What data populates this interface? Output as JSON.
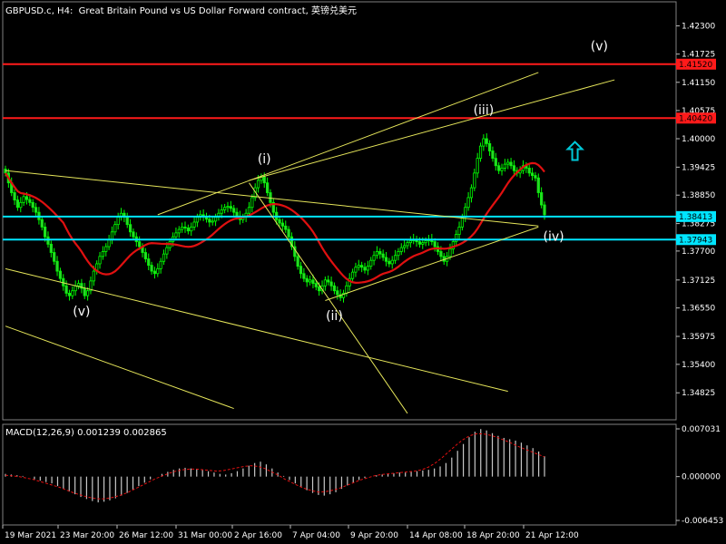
{
  "header": {
    "symbol": "GBPUSD.c",
    "timeframe": "H4",
    "description": "Great Britain Pound vs US Dollar Forward contract, 英镑兑美元"
  },
  "macd": {
    "label": "MACD(12,26,9) 0.001239 0.002865",
    "ticks": [
      "0.007031",
      "0.000000",
      "-0.006453"
    ],
    "tick_values": [
      0.007031,
      0.0,
      -0.006453
    ]
  },
  "colors": {
    "background": "#000000",
    "candle_up": "#00ff00",
    "candle_body": "#32cd32",
    "ma": "#e01010",
    "trend_lines": "#e5e55a",
    "horizontal_red": "#ff1a1a",
    "horizontal_cyan": "#00e5ff",
    "arrow": "#00c8d8",
    "text": "#ffffff",
    "price_tag_red": "#ff1a1a",
    "price_tag_cyan": "#00e5ff"
  },
  "chart_data": {
    "type": "candlestick",
    "symbol": "GBPUSD.c",
    "timeframe": "H4",
    "y_ticks": [
      1.423,
      1.41725,
      1.4115,
      1.40575,
      1.4,
      1.3942,
      1.3885,
      1.3827,
      1.3771,
      1.3712,
      1.3655,
      1.3597,
      1.354,
      1.3482
    ],
    "y_tick_labels": [
      "1.42300",
      "1.41725",
      "1.41150",
      "1.40575",
      "1.40000",
      "1.39425",
      "1.38850",
      "1.38275",
      "1.37700",
      "1.37125",
      "1.36550",
      "1.35975",
      "1.35400",
      "1.34825"
    ],
    "x_tick_labels": [
      "19 Mar 2021",
      "23 Mar 20:00",
      "26 Mar 12:00",
      "31 Mar 00:00",
      "2 Apr 16:00",
      "7 Apr 04:00",
      "9 Apr 20:00",
      "14 Apr 08:00",
      "18 Apr 20:00",
      "21 Apr 12:00"
    ],
    "ylim": [
      1.3427,
      1.4268
    ],
    "close_series": [
      1.393,
      1.391,
      1.389,
      1.3875,
      1.386,
      1.387,
      1.3882,
      1.3876,
      1.387,
      1.386,
      1.385,
      1.3835,
      1.382,
      1.38,
      1.3785,
      1.3768,
      1.375,
      1.373,
      1.3715,
      1.37,
      1.3685,
      1.368,
      1.369,
      1.37,
      1.3705,
      1.3695,
      1.368,
      1.369,
      1.371,
      1.373,
      1.3745,
      1.376,
      1.377,
      1.378,
      1.3795,
      1.381,
      1.3825,
      1.384,
      1.3848,
      1.384,
      1.3825,
      1.381,
      1.38,
      1.379,
      1.378,
      1.3768,
      1.3755,
      1.3742,
      1.373,
      1.3725,
      1.3735,
      1.375,
      1.3765,
      1.3778,
      1.379,
      1.38,
      1.3808,
      1.3815,
      1.382,
      1.3818,
      1.3812,
      1.382,
      1.383,
      1.384,
      1.3845,
      1.3842,
      1.3836,
      1.383,
      1.3832,
      1.384,
      1.3848,
      1.3855,
      1.386,
      1.3862,
      1.3858,
      1.385,
      1.3842,
      1.3835,
      1.384,
      1.3848,
      1.386,
      1.388,
      1.39,
      1.3915,
      1.3922,
      1.391,
      1.389,
      1.387,
      1.385,
      1.3835,
      1.3828,
      1.3822,
      1.3815,
      1.38,
      1.378,
      1.376,
      1.374,
      1.3725,
      1.3715,
      1.3708,
      1.3712,
      1.3705,
      1.3698,
      1.369,
      1.37,
      1.3712,
      1.3708,
      1.37,
      1.369,
      1.3682,
      1.3676,
      1.3685,
      1.37,
      1.3715,
      1.3728,
      1.3738,
      1.3742,
      1.3738,
      1.3732,
      1.374,
      1.3752,
      1.3762,
      1.377,
      1.3765,
      1.3758,
      1.375,
      1.3745,
      1.3752,
      1.3762,
      1.377,
      1.3778,
      1.3782,
      1.3788,
      1.3792,
      1.3795,
      1.379,
      1.3785,
      1.3788,
      1.3792,
      1.3795,
      1.379,
      1.378,
      1.377,
      1.376,
      1.375,
      1.376,
      1.3775,
      1.379,
      1.3805,
      1.382,
      1.384,
      1.386,
      1.388,
      1.39,
      1.393,
      1.396,
      1.3985,
      1.4,
      1.399,
      1.3975,
      1.396,
      1.3945,
      1.3935,
      1.394,
      1.3948,
      1.3952,
      1.3945,
      1.3935,
      1.393,
      1.3935,
      1.3945,
      1.394,
      1.393,
      1.3925,
      1.392,
      1.389,
      1.3865,
      1.3845
    ],
    "lines": {
      "horizontal": [
        {
          "price": 1.4152,
          "label": "1.41520",
          "color": "red"
        },
        {
          "price": 1.4042,
          "label": "1.40420",
          "color": "red"
        },
        {
          "price": 1.38413,
          "label": "1.38413",
          "color": "cyan"
        },
        {
          "price": 1.37943,
          "label": "1.37943",
          "color": "cyan"
        }
      ]
    },
    "annotations": [
      "(v)",
      "(i)",
      "(ii)",
      "(iii)",
      "(iv)",
      "(v)"
    ],
    "macd": {
      "histogram": [
        0.0004,
        0.0003,
        0.0002,
        0.0001,
        0.0,
        -0.0004,
        -0.0006,
        -0.0008,
        -0.001,
        -0.0014,
        -0.0018,
        -0.0022,
        -0.0026,
        -0.003,
        -0.0033,
        -0.0036,
        -0.0038,
        -0.0037,
        -0.0035,
        -0.0032,
        -0.0028,
        -0.0024,
        -0.0019,
        -0.0014,
        -0.0009,
        -0.0004,
        0.0,
        0.0004,
        0.0007,
        0.001,
        0.0012,
        0.0013,
        0.0012,
        0.0011,
        0.001,
        0.0008,
        0.0006,
        0.0004,
        0.0003,
        0.0005,
        0.0008,
        0.0012,
        0.0016,
        0.002,
        0.0022,
        0.0018,
        0.0012,
        0.0006,
        0.0001,
        -0.0005,
        -0.001,
        -0.0015,
        -0.002,
        -0.0024,
        -0.0027,
        -0.0028,
        -0.0026,
        -0.0023,
        -0.0018,
        -0.0013,
        -0.0009,
        -0.0005,
        -0.0002,
        0.0,
        0.0002,
        0.0003,
        0.0004,
        0.0005,
        0.0006,
        0.0006,
        0.0007,
        0.0008,
        0.0009,
        0.001,
        0.0012,
        0.0015,
        0.002,
        0.0028,
        0.0038,
        0.0048,
        0.0058,
        0.0066,
        0.007,
        0.0068,
        0.0064,
        0.006,
        0.0057,
        0.0055,
        0.0053,
        0.005,
        0.0046,
        0.0042,
        0.0037,
        0.003
      ],
      "signal": [
        0.0002,
        0.0001,
        0.0,
        -0.0002,
        -0.0004,
        -0.0007,
        -0.001,
        -0.0013,
        -0.0016,
        -0.002,
        -0.0024,
        -0.0027,
        -0.003,
        -0.0032,
        -0.0033,
        -0.0032,
        -0.003,
        -0.0027,
        -0.0023,
        -0.0018,
        -0.0013,
        -0.0008,
        -0.0003,
        0.0001,
        0.0005,
        0.0008,
        0.001,
        0.0011,
        0.0011,
        0.001,
        0.0009,
        0.0008,
        0.0009,
        0.0011,
        0.0013,
        0.0015,
        0.0016,
        0.0015,
        0.0012,
        0.0007,
        0.0002,
        -0.0004,
        -0.0009,
        -0.0014,
        -0.0018,
        -0.0021,
        -0.0023,
        -0.0022,
        -0.002,
        -0.0017,
        -0.0013,
        -0.0009,
        -0.0005,
        -0.0002,
        0.0001,
        0.0003,
        0.0004,
        0.0005,
        0.0006,
        0.0007,
        0.0008,
        0.001,
        0.0014,
        0.002,
        0.0028,
        0.0037,
        0.0046,
        0.0054,
        0.006,
        0.0063,
        0.0063,
        0.0061,
        0.0058,
        0.0054,
        0.005,
        0.0045,
        0.0041,
        0.0037,
        0.0033,
        0.0029
      ]
    }
  }
}
